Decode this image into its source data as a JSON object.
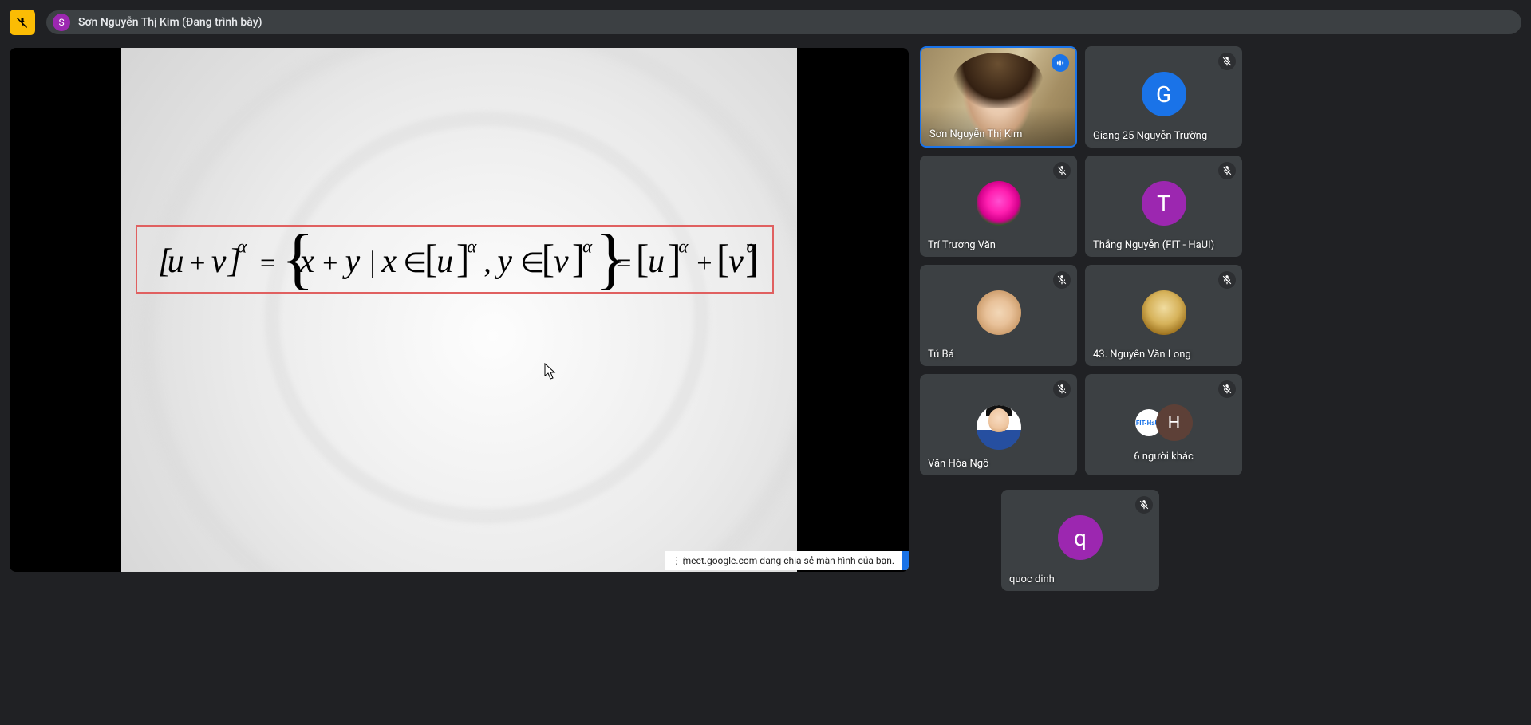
{
  "header": {
    "presenter_initial": "S",
    "presenter_label": "Sơn Nguyễn Thị Kim (Đang trình bày)"
  },
  "slide": {
    "equation_tex": "[u+v]^{\\alpha} = \\{ x + y \\mid x \\in [u]^{\\alpha}, y \\in [v]^{\\alpha} \\} = [u]^{\\alpha} + [v]^{\\alpha}",
    "highlight_color": "#e06060"
  },
  "share_notice": {
    "text": "meet.google.com đang chia sẻ màn hình của bạn."
  },
  "participants": [
    {
      "name": "Sơn Nguyễn Thị Kim",
      "type": "video",
      "speaking": true
    },
    {
      "name": "Giang 25 Nguyễn Trường",
      "type": "initial",
      "initial": "G",
      "color": "#1a73e8",
      "muted": true
    },
    {
      "name": "Trí Trương Văn",
      "type": "image",
      "image": "lotus",
      "muted": true
    },
    {
      "name": "Thắng Nguyễn (FIT - HaUI)",
      "type": "initial",
      "initial": "T",
      "color": "#9c27b0",
      "muted": true
    },
    {
      "name": "Tú Bá",
      "type": "image",
      "image": "shiba",
      "muted": true
    },
    {
      "name": "43. Nguyễn Văn Long",
      "type": "image",
      "image": "buddha",
      "muted": true
    },
    {
      "name": "Văn Hòa Ngô",
      "type": "image",
      "image": "man",
      "muted": true
    }
  ],
  "overflow_tile": {
    "label": "6 người khác",
    "small_badge": "FIT-HaUI",
    "big_initial": "H",
    "muted": true
  },
  "self_tile": {
    "name": "quoc dinh",
    "initial": "q",
    "color": "#9c27b0",
    "muted": true
  },
  "colors": {
    "background": "#202124",
    "tile_bg": "#3c4043",
    "accent": "#1a73e8"
  }
}
